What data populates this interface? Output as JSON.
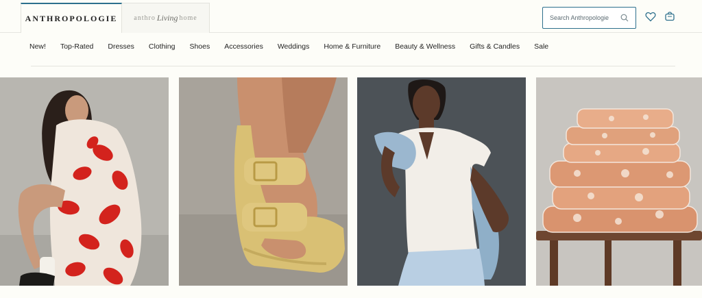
{
  "brand": {
    "main_tab": "ANTHROPOLOGIE",
    "home_tab_prefix": "anthro",
    "home_tab_script": "Living",
    "home_tab_suffix": "home"
  },
  "search": {
    "placeholder": "Search Anthropologie"
  },
  "icons": {
    "search": "search-icon",
    "wishlist": "heart-icon",
    "cart": "shopping-bag-icon"
  },
  "nav": {
    "items": [
      {
        "label": "New!"
      },
      {
        "label": "Top-Rated"
      },
      {
        "label": "Dresses"
      },
      {
        "label": "Clothing"
      },
      {
        "label": "Shoes"
      },
      {
        "label": "Accessories"
      },
      {
        "label": "Weddings"
      },
      {
        "label": "Home & Furniture"
      },
      {
        "label": "Beauty & Wellness"
      },
      {
        "label": "Gifts & Candles"
      },
      {
        "label": "Sale"
      }
    ]
  },
  "colors": {
    "accent": "#2c6f8c",
    "background": "#fdfdf8"
  }
}
